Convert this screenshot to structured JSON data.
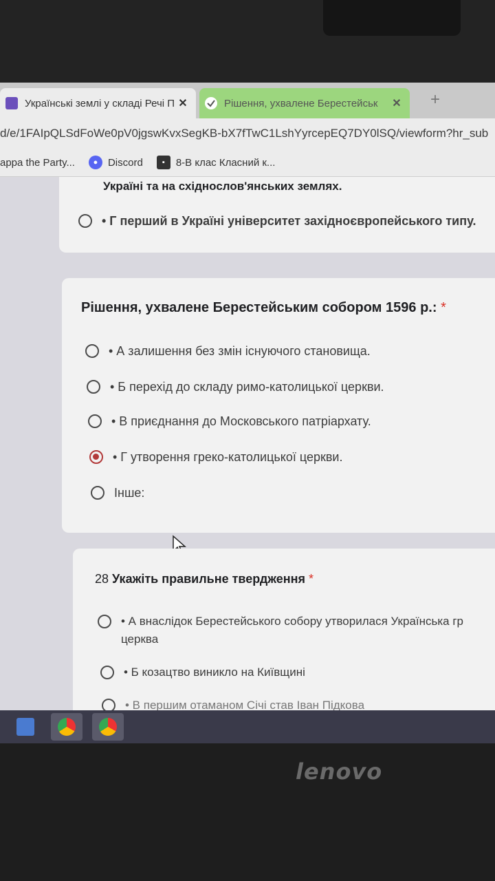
{
  "tabs": [
    {
      "title": "Українські землі у складі Речі П",
      "close": "✕"
    },
    {
      "title": "Рішення, ухвалене Берестейськ",
      "close": "✕"
    }
  ],
  "newtab": "+",
  "address": {
    "url": "d/e/1FAIpQLSdFoWe0pV0jgswKvxSegKB-bX7fTwC1LshYyrcepEQ7DY0lSQ/viewform?hr_sub"
  },
  "bookmarks": [
    {
      "label": "appa the Party..."
    },
    {
      "label": "Discord"
    },
    {
      "label": "8-В клас Класний к..."
    }
  ],
  "prev_question": {
    "partial_text": "Україні та на східнослов'янських землях.",
    "option_g": "• Г перший в Україні університет західноєвропейського типу."
  },
  "question": {
    "title": "Рішення, ухвалене Берестейським собором 1596 р.:",
    "required": "*",
    "options": [
      {
        "text": "• А залишення без змін існуючого становища.",
        "checked": false
      },
      {
        "text": "• Б перехід до складу римо-католицької церкви.",
        "checked": false
      },
      {
        "text": "• В приєднання до Московського патріархату.",
        "checked": false
      },
      {
        "text": "• Г утворення греко-католицької церкви.",
        "checked": true
      },
      {
        "text": "Інше:",
        "checked": false
      }
    ]
  },
  "question28": {
    "number": "28",
    "title": "Укажіть правильне твердження",
    "required": "*",
    "options": [
      {
        "text": "• А внаслідок Берестейського собору утворилася Українська гр церква"
      },
      {
        "text": "• Б козацтво виникло на Київщині"
      },
      {
        "text": "• В першим отаманом Січі став Іван Підкова"
      }
    ]
  },
  "device": {
    "brand": "lenovo"
  }
}
